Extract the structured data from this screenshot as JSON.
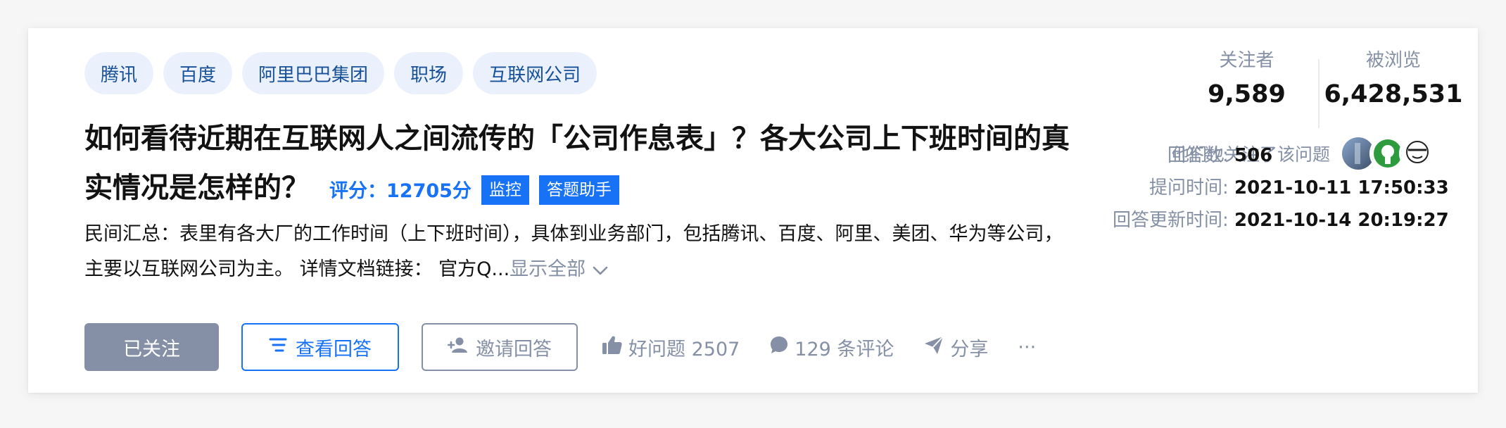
{
  "tags": [
    "腾讯",
    "百度",
    "阿里巴巴集团",
    "职场",
    "互联网公司"
  ],
  "question": {
    "title": "如何看待近期在互联网人之间流传的「公司作息表」？各大公司上下班时间的真实情况是怎样的？",
    "rating": "评分：12705分",
    "badge_monitor": "监控",
    "badge_assistant": "答题助手",
    "excerpt": "民间汇总：表里有各大厂的工作时间（上下班时间），具体到业务部门，包括腾讯、百度、阿里、美团、华为等公司，主要以互联网公司为主。 详情文档链接： 官方Q...",
    "show_all": "显示全部"
  },
  "actions": {
    "followed": "已关注",
    "view_answers": "查看回答",
    "invite": "邀请回答",
    "good_question": "好问题 2507",
    "comments": "129 条评论",
    "share": "分享",
    "more": "···"
  },
  "stats": {
    "followers_label": "关注者",
    "followers": "9,589",
    "views_label": "被浏览",
    "views": "6,428,531",
    "also_followed": "他们也关注了该问题",
    "answers_label": "回答数:",
    "answers": "506",
    "asked_label": "提问时间:",
    "asked": "2021-10-11 17:50:33",
    "updated_label": "回答更新时间:",
    "updated": "2021-10-14 20:19:27"
  },
  "colors": {
    "brand_blue": "#1772f6",
    "tag_bg": "#ebf0fd",
    "tag_text": "#175199",
    "gray": "#8590a6"
  },
  "icons": [
    "thumb-up-icon",
    "comment-icon",
    "share-icon",
    "view-answers-icon",
    "invite-icon",
    "chevron-down-icon"
  ]
}
